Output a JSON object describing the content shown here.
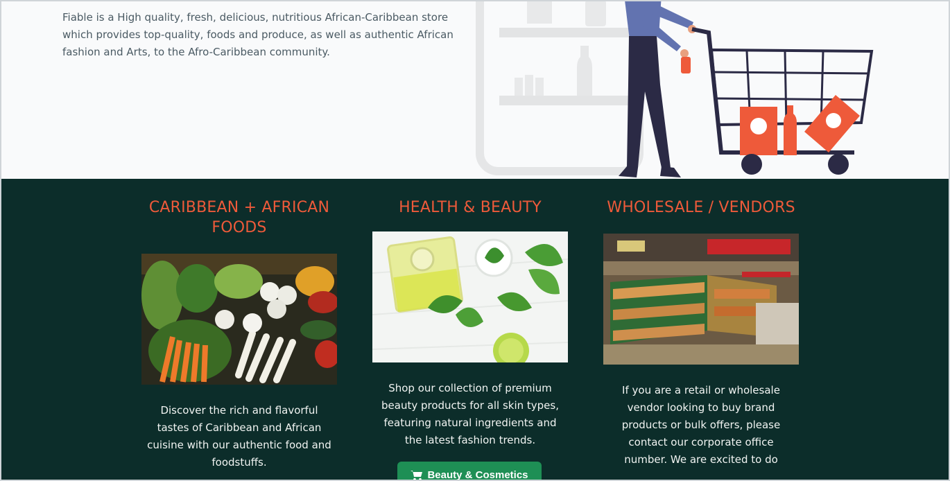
{
  "hero": {
    "description": "Fiable is a High quality, fresh, delicious, nutritious African-Caribbean store which provides top-quality, foods and produce, as well as authentic African fashion and Arts, to the Afro-Caribbean community."
  },
  "categories": [
    {
      "title": "CARIBBEAN + AFRICAN FOODS",
      "image_icon": "vegetables-market-image",
      "description": "Discover the rich and flavorful tastes of Caribbean and African cuisine with our authentic food and foodstuffs."
    },
    {
      "title": "HEALTH & BEAUTY",
      "image_icon": "oil-and-herbs-image",
      "description": "Shop our collection of premium beauty products for all skin types, featuring natural ingredients and the latest fashion trends.",
      "button_label": "Beauty & Cosmetics"
    },
    {
      "title": "WHOLESALE / VENDORS",
      "image_icon": "supermarket-aisle-image",
      "description": "If you are a retail or wholesale vendor looking to buy brand products or bulk offers, please contact our corporate office number. We are excited to do"
    }
  ],
  "colors": {
    "accent": "#ee5a3a",
    "dark_section": "#0c2d2a",
    "button": "#1e8f55"
  }
}
